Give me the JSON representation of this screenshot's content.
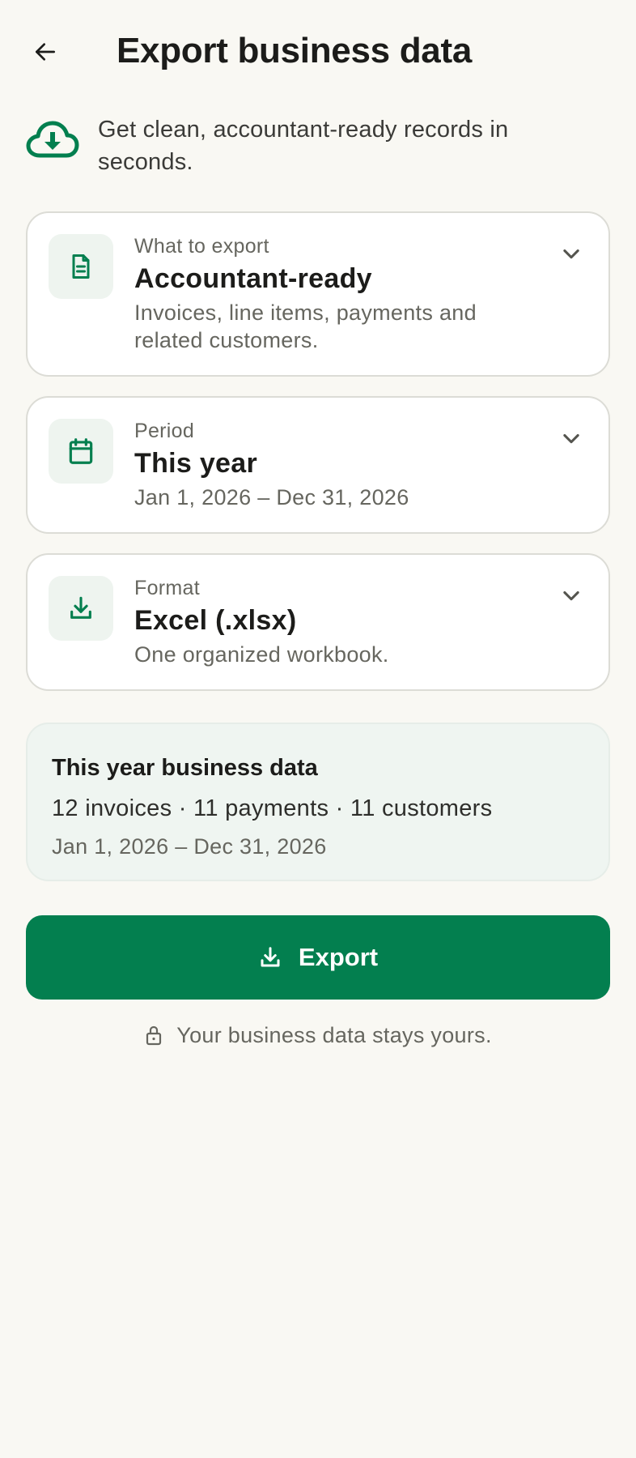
{
  "header": {
    "title": "Export business data",
    "back_icon": "arrow-left-icon"
  },
  "intro": {
    "icon": "cloud-download-icon",
    "text": "Get clean, accountant-ready records in seconds."
  },
  "options": [
    {
      "icon": "document-icon",
      "label": "What to export",
      "value": "Accountant-ready",
      "description": "Invoices, line items, payments and related customers."
    },
    {
      "icon": "calendar-icon",
      "label": "Period",
      "value": "This year",
      "description": "Jan 1, 2026 – Dec 31, 2026"
    },
    {
      "icon": "download-icon",
      "label": "Format",
      "value": "Excel (.xlsx)",
      "description": "One organized workbook."
    }
  ],
  "summary": {
    "title": "This year business data",
    "counts": "12 invoices · 11 payments · 11 customers",
    "dates": "Jan 1, 2026 – Dec 31, 2026"
  },
  "export_button": {
    "label": "Export",
    "icon": "download-icon"
  },
  "privacy": {
    "icon": "lock-icon",
    "text": "Your business data stays yours."
  },
  "colors": {
    "background": "#f9f8f3",
    "accent": "#037f4f",
    "accent_soft": "#eef4ef",
    "summary_bg": "#eff5f1",
    "muted_text": "#66665f"
  }
}
